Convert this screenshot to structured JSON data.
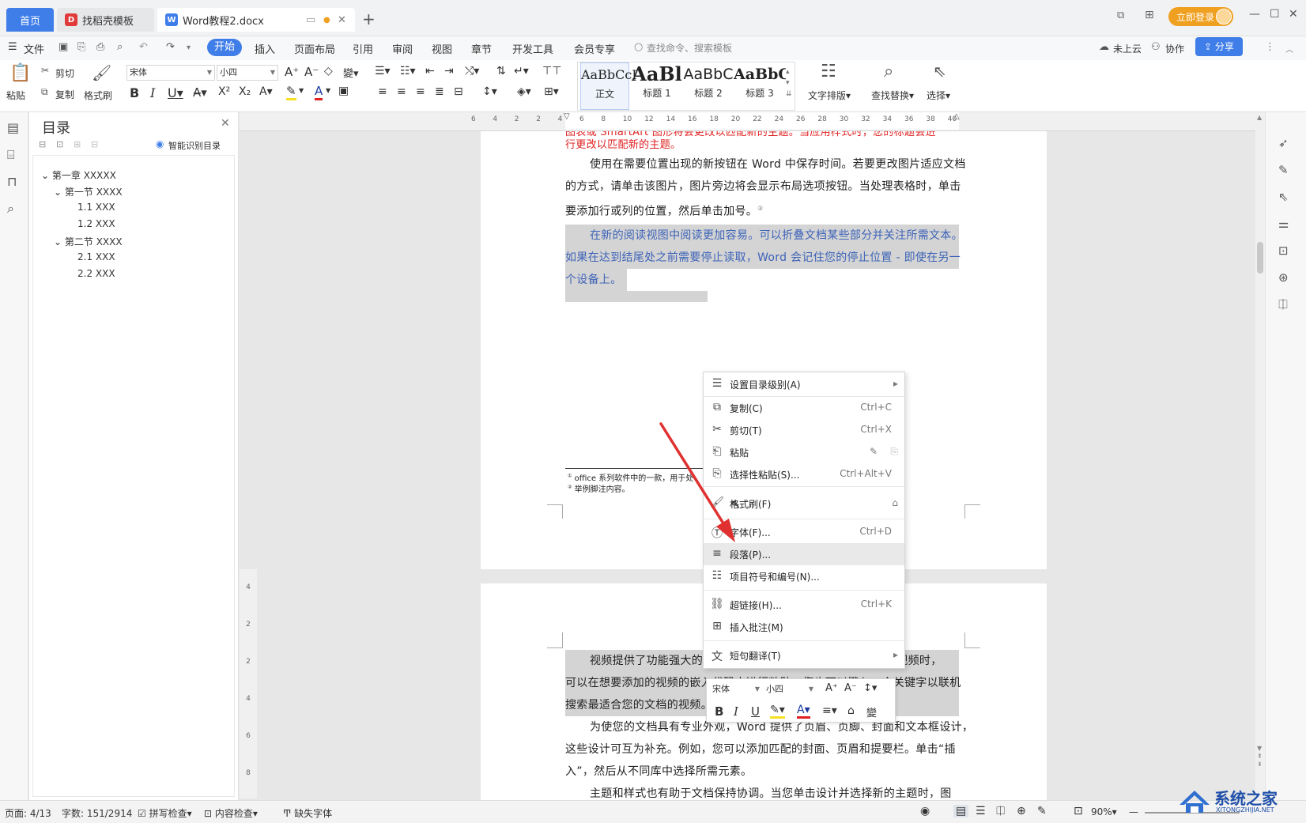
{
  "titlebar": {
    "tab_home": "首页",
    "tab_template": "找稻壳模板",
    "tab_doc": "Word教程2.docx",
    "login": "立即登录"
  },
  "menubar": {
    "file": "文件",
    "items": [
      "开始",
      "插入",
      "页面布局",
      "引用",
      "审阅",
      "视图",
      "章节",
      "开发工具",
      "会员专享"
    ],
    "search": "查找命令、搜索模板",
    "cloud": "未上云",
    "collab": "协作",
    "share": "分享"
  },
  "ribbon": {
    "paste": "粘贴",
    "cut": "剪切",
    "copy": "复制",
    "format_painter": "格式刷",
    "font_name": "宋体",
    "font_size": "小四",
    "styles": [
      {
        "preview": "AaBbCcI",
        "label": "正文"
      },
      {
        "preview": "AaBl",
        "label": "标题 1"
      },
      {
        "preview": "AaBbC",
        "label": "标题 2"
      },
      {
        "preview": "AaBbC",
        "label": "标题 3"
      }
    ],
    "text_layout": "文字排版",
    "find_replace": "查找替换",
    "select": "选择"
  },
  "toc": {
    "title": "目录",
    "smart": "智能识别目录",
    "items": [
      "第一章 XXXXX",
      "第一节 XXXX",
      "1.1 XXX",
      "1.2 XXX",
      "第二节 XXXX",
      "2.1 XXX",
      "2.2 XXX"
    ]
  },
  "ruler": [
    "6",
    "4",
    "2",
    "2",
    "4",
    "6",
    "8",
    "10",
    "12",
    "14",
    "16",
    "18",
    "20",
    "22",
    "24",
    "26",
    "28",
    "30",
    "32",
    "34",
    "36",
    "38",
    "40"
  ],
  "doc": {
    "red1": "图表或 SmartArt 图形将会更改以匹配新的主题。当应用样式时，您的标题会进",
    "red2": "行更改以匹配新的主题。",
    "p1_1": "使用在需要位置出现的新按钮在 Word 中保存时间。若要更改图片适应文档",
    "p1_2": "的方式，请单击该图片，图片旁边将会显示布局选项按钮。当处理表格时，单击",
    "p1_3": "要添加行或列的位置，然后单击加号。",
    "p1_note": "②",
    "p2_1": "在新的阅读视图中阅读更加容易。可以折叠文档某些部分并关注所需文本。",
    "p2_2": "如果在达到结尾处之前需要停止读取，Word 会记住您的停止位置 - 即使在另一",
    "p2_3": "个设备上。",
    "fn1": "office 系列软件中的一款，用于处",
    "fn2": "举例脚注内容。",
    "p3_1": "视频提供了功能强大的",
    "p3_1b": "机视频时，",
    "p3_2": "可以在想要添加的视频的嵌入代码中进行粘贴。您也可以键入一个关键字以联机",
    "p3_3": "搜索最适合您的文档的视频。",
    "p4_1": "为使您的文档具有专业外观，Word 提供了页眉、页脚、封面和文本框设计，",
    "p4_2": "这些设计可互为补充。例如，您可以添加匹配的封面、页眉和提要栏。单击“插",
    "p4_3": "入”，然后从不同库中选择所需元素。",
    "p5_1": "主题和样式也有助于文档保持协调。当您单击设计并选择新的主题时，图"
  },
  "context_menu": {
    "items": [
      {
        "label": "设置目录级别(A)",
        "shortcut": ""
      },
      {
        "label": "复制(C)",
        "shortcut": "Ctrl+C"
      },
      {
        "label": "剪切(T)",
        "shortcut": "Ctrl+X"
      },
      {
        "label": "粘贴",
        "shortcut": ""
      },
      {
        "label": "选择性粘贴(S)...",
        "shortcut": "Ctrl+Alt+V"
      },
      {
        "label": "格式刷(F)",
        "shortcut": ""
      },
      {
        "label": "字体(F)...",
        "shortcut": "Ctrl+D"
      },
      {
        "label": "段落(P)...",
        "shortcut": ""
      },
      {
        "label": "项目符号和编号(N)...",
        "shortcut": ""
      },
      {
        "label": "超链接(H)...",
        "shortcut": "Ctrl+K"
      },
      {
        "label": "插入批注(M)",
        "shortcut": ""
      },
      {
        "label": "短句翻译(T)",
        "shortcut": ""
      }
    ]
  },
  "mini_toolbar": {
    "font_name": "宋体",
    "font_size": "小四"
  },
  "statusbar": {
    "page": "页面: 4/13",
    "words": "字数: 151/2914",
    "spell": "拼写检查",
    "content": "内容检查",
    "missing_font": "缺失字体",
    "zoom": "90%"
  },
  "watermark": {
    "brand": "系统之家",
    "url": "XITONGZHIJIA.NET"
  },
  "colors": {
    "accent": "#3f7de8",
    "red_text": "#e02020",
    "arrow": "#e03030",
    "login": "#f0a020"
  }
}
